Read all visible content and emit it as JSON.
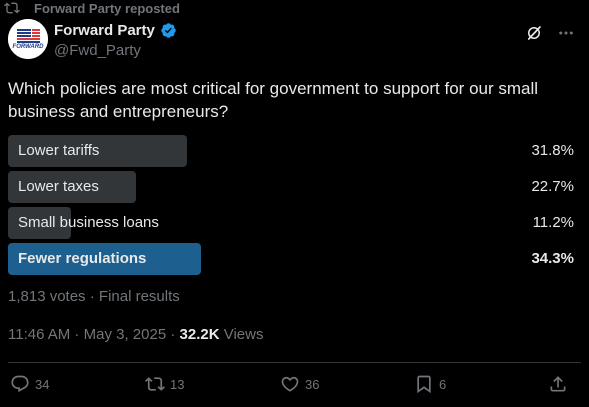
{
  "repost": {
    "text": "Forward Party reposted",
    "icon": "repost-icon"
  },
  "author": {
    "name": "Forward Party",
    "handle": "@Fwd_Party",
    "verified": true,
    "avatar_text": "FORWARD"
  },
  "tweet": {
    "question": "Which policies are most critical for government to support for our small business and entrepreneurs?"
  },
  "poll": {
    "options": [
      {
        "label": "Lower tariffs",
        "percent": "31.8%",
        "value": 31.8,
        "winner": false
      },
      {
        "label": "Lower taxes",
        "percent": "22.7%",
        "value": 22.7,
        "winner": false
      },
      {
        "label": "Small business loans",
        "percent": "11.2%",
        "value": 11.2,
        "winner": false
      },
      {
        "label": "Fewer regulations",
        "percent": "34.3%",
        "value": 34.3,
        "winner": true
      }
    ],
    "votes": "1,813 votes",
    "status": "Final results",
    "separator": " · "
  },
  "meta": {
    "time": "11:46 AM",
    "date": "May 3, 2025",
    "separator": " · ",
    "views_count": "32.2K",
    "views_label": "Views"
  },
  "actions": {
    "replies": "34",
    "reposts": "13",
    "likes": "36",
    "bookmarks": "6"
  },
  "colors": {
    "background": "#000000",
    "text": "#e7e9ea",
    "muted": "#71767b",
    "bar": "#333639",
    "winner_bar": "#1d5f8f",
    "verified": "#1d9bf0"
  }
}
